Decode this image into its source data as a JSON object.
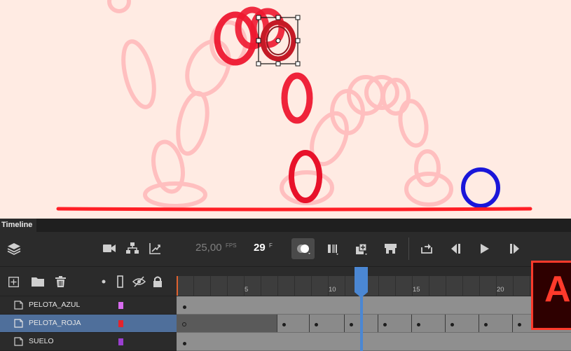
{
  "app": {
    "panel_tab": "Timeline",
    "accent_color": "#4b87d3",
    "logo_letter": "A"
  },
  "controls": {
    "fps_value": "25,00",
    "fps_unit": "FPS",
    "current_frame": "29",
    "frame_unit": "F"
  },
  "ruler": {
    "labels": [
      "5",
      "10",
      "15",
      "20"
    ]
  },
  "layers": [
    {
      "name": "PELOTA_AZUL",
      "color": "#d86cf0",
      "selected": false
    },
    {
      "name": "PELOTA_ROJA",
      "color": "#e5232b",
      "selected": true
    },
    {
      "name": "SUELO",
      "color": "#9b3fd1",
      "selected": false
    }
  ],
  "stage": {
    "ground_color": "#ff1f26",
    "red_ball_color": "#e8122a",
    "blue_ball_color": "#1a16d9",
    "background_color": "#ffebe3"
  }
}
